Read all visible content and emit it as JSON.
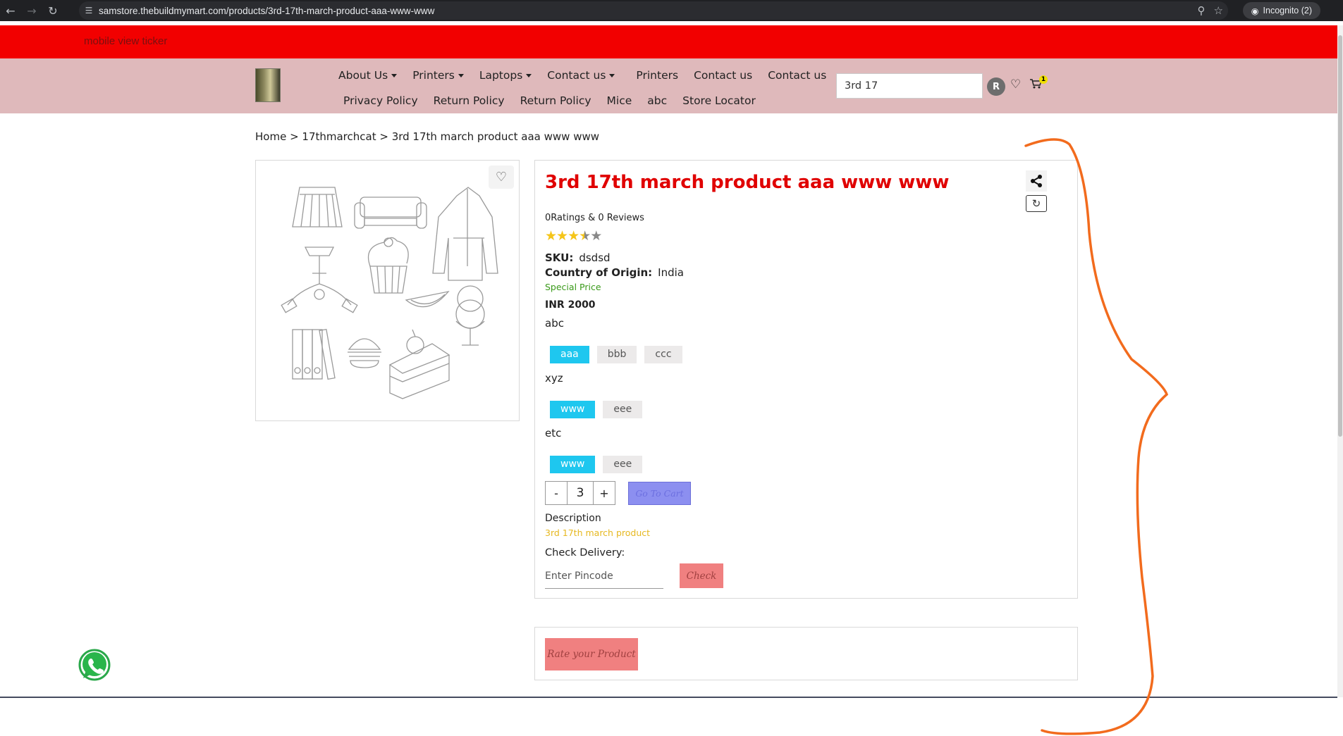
{
  "browser": {
    "url": "samstore.thebuildmymart.com/products/3rd-17th-march-product-aaa-www-www",
    "incognito_label": "Incognito (2)",
    "icons": [
      "back-icon",
      "forward-icon",
      "reload-icon",
      "site-info-icon",
      "zoom-icon",
      "bookmark-star-icon",
      "incognito-icon"
    ]
  },
  "ticker": {
    "text": "mobile view ticker"
  },
  "header": {
    "menu_row1": [
      {
        "label": "About Us",
        "dropdown": true
      },
      {
        "label": "Printers",
        "dropdown": true
      },
      {
        "label": "Laptops",
        "dropdown": true
      },
      {
        "label": "Contact us",
        "dropdown": true
      },
      {
        "label": "Printers",
        "dropdown": false
      },
      {
        "label": "Contact us",
        "dropdown": false
      },
      {
        "label": "Contact us",
        "dropdown": false
      }
    ],
    "menu_row2": [
      "Privacy Policy",
      "Return Policy",
      "Return Policy",
      "Mice",
      "abc",
      "Store Locator"
    ],
    "search_value": "3rd 17",
    "avatar_initial": "R",
    "cart_count": "1"
  },
  "breadcrumb": "Home > 17thmarchcat > 3rd 17th march product aaa www www",
  "product": {
    "title": "3rd 17th march product aaa www www",
    "ratings_text": "0Ratings & 0 Reviews",
    "rating_stars": 3.5,
    "sku_label": "SKU:",
    "sku_value": "dsdsd",
    "origin_label": "Country of Origin:",
    "origin_value": "India",
    "special_label": "Special Price",
    "price": "INR 2000",
    "options": [
      {
        "name": "abc",
        "values": [
          "aaa",
          "bbb",
          "ccc"
        ],
        "selected": "aaa"
      },
      {
        "name": "xyz",
        "values": [
          "www",
          "eee"
        ],
        "selected": "www"
      },
      {
        "name": "etc",
        "values": [
          "www",
          "eee"
        ],
        "selected": "www"
      }
    ],
    "quantity": "3",
    "qty_minus": "-",
    "qty_plus": "+",
    "goto_cart_label": "Go To Cart",
    "description_label": "Description",
    "description_text": "3rd 17th march product",
    "check_delivery_label": "Check Delivery:",
    "pincode_placeholder": "Enter Pincode",
    "check_label": "Check"
  },
  "rate": {
    "button_label": "Rate your Product"
  },
  "colors": {
    "ticker": "#f20000",
    "header": "#dfb9bb",
    "title": "#e00000",
    "chip_selected": "#1ec7ef",
    "goto_cart": "#8c8ff0",
    "check_button": "#f08080",
    "annotation_stroke": "#f26b1d"
  }
}
